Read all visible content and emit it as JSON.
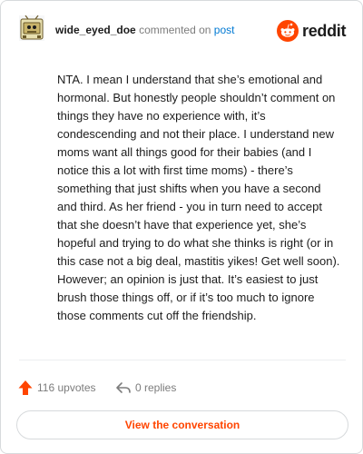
{
  "header": {
    "username": "wide_eyed_doe",
    "action_text": "commented on",
    "post_link": "post",
    "brand": "reddit"
  },
  "comment": {
    "body": "NTA. I mean I understand that she’s emotional and hormonal. But honestly people shouldn’t comment on things they have no experience with, it’s condescending and not their place. I understand new moms want all things good for their babies (and I notice this a lot with first time moms) - there’s something that just shifts when you have a second and third. As her friend - you in turn need to accept that she doesn’t have that experience yet, she’s hopeful and trying to do what she thinks is right (or in this case not a big deal, mastitis yikes! Get well soon). However; an opinion is just that. It’s easiest to just brush those things off, or if it’s too much to ignore those comments cut off the friendship."
  },
  "actions": {
    "upvotes": "116 upvotes",
    "replies": "0 replies"
  },
  "footer": {
    "button_label": "View the conversation"
  },
  "colors": {
    "reddit_orange": "#ff4500",
    "link_blue": "#0079d3",
    "muted_text": "#7c7c7c"
  },
  "icons": {
    "avatar": "snoo-avatar-icon",
    "brand": "reddit-logo-icon",
    "upvote": "upvote-arrow-icon",
    "reply": "reply-arrow-icon"
  }
}
